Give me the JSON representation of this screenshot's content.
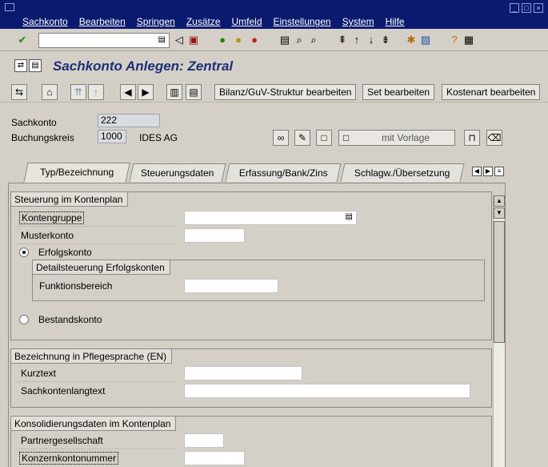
{
  "menu": [
    "Sachkonto",
    "Bearbeiten",
    "Springen",
    "Zusätze",
    "Umfeld",
    "Einstellungen",
    "System",
    "Hilfe"
  ],
  "title": "Sachkonto Anlegen: Zentral",
  "app_toolbar": {
    "btn1": "Bilanz/GuV-Struktur bearbeiten",
    "btn2": "Set bearbeiten",
    "btn3": "Kostenart bearbeiten"
  },
  "header": {
    "sachkonto_label": "Sachkonto",
    "sachkonto_value": "222",
    "bukrs_label": "Buchungskreis",
    "bukrs_value": "1000",
    "bukrs_name": "IDES AG",
    "mit_vorlage": "mit Vorlage"
  },
  "tabs": [
    "Typ/Bezeichnung",
    "Steuerungsdaten",
    "Erfassung/Bank/Zins",
    "Schlagw./Übersetzung"
  ],
  "groups": {
    "steuerung": {
      "title": "Steuerung im Kontenplan",
      "kontengruppe": "Kontengruppe",
      "musterkonto": "Musterkonto",
      "erfolgskonto": "Erfolgskonto",
      "detail_title": "Detailsteuerung Erfolgskonten",
      "funktionsbereich": "Funktionsbereich",
      "bestandskonto": "Bestandskonto"
    },
    "bezeichnung": {
      "title": "Bezeichnung in Pflegesprache (EN)",
      "kurztext": "Kurztext",
      "langtext": "Sachkontenlangtext"
    },
    "konsolidierung": {
      "title": "Konsolidierungsdaten im Kontenplan",
      "partner": "Partnergesellschaft",
      "konzernkonto": "Konzernkontonummer"
    }
  },
  "colors": {
    "menubar": "#0a1a6e",
    "title": "#1c3078",
    "background": "#d4d0c8"
  }
}
